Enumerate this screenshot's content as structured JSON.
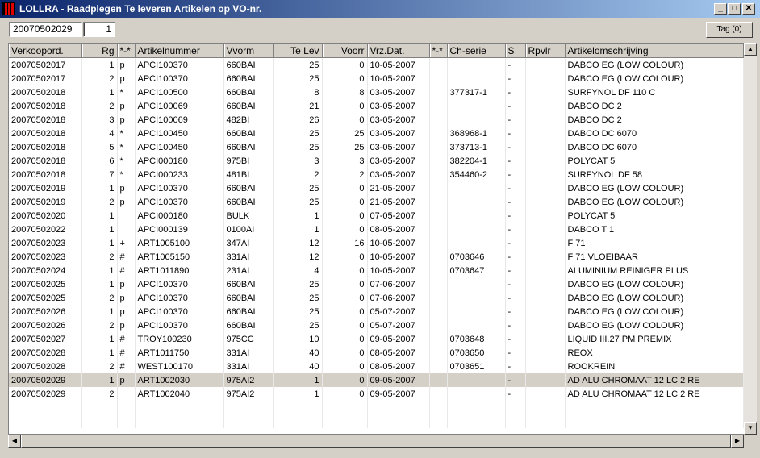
{
  "window": {
    "title": "LOLLRA - Raadplegen Te leveren Artikelen op VO-nr.",
    "minimize": "_",
    "maximize": "□",
    "close": "✕"
  },
  "toolbar": {
    "order_value": "20070502029",
    "row_value": "1",
    "tag_label": "Tag (0)"
  },
  "grid": {
    "columns": [
      "Verkoopord.",
      "Rg",
      "*-*",
      "Artikelnummer",
      "Vvorm",
      "Te Lev",
      "Voorr",
      "Vrz.Dat.",
      "*-*",
      "Ch-serie",
      "S",
      "Rpvlr",
      "Artikelomschrijving"
    ],
    "rows": [
      [
        "20070502017",
        "1",
        "p",
        "APCI100370",
        "660BAI",
        "25",
        "0",
        "10-05-2007",
        "",
        "",
        "-",
        "",
        "DABCO EG (LOW COLOUR)"
      ],
      [
        "20070502017",
        "2",
        "p",
        "APCI100370",
        "660BAI",
        "25",
        "0",
        "10-05-2007",
        "",
        "",
        "-",
        "",
        "DABCO EG (LOW COLOUR)"
      ],
      [
        "20070502018",
        "1",
        "*",
        "APCI100500",
        "660BAI",
        "8",
        "8",
        "03-05-2007",
        "",
        "377317-1",
        "-",
        "",
        "SURFYNOL DF 110 C"
      ],
      [
        "20070502018",
        "2",
        "p",
        "APCI100069",
        "660BAI",
        "21",
        "0",
        "03-05-2007",
        "",
        "",
        "-",
        "",
        "DABCO DC 2"
      ],
      [
        "20070502018",
        "3",
        "p",
        "APCI100069",
        "482BI",
        "26",
        "0",
        "03-05-2007",
        "",
        "",
        "-",
        "",
        "DABCO DC 2"
      ],
      [
        "20070502018",
        "4",
        "*",
        "APCI100450",
        "660BAI",
        "25",
        "25",
        "03-05-2007",
        "",
        "368968-1",
        "-",
        "",
        "DABCO DC 6070"
      ],
      [
        "20070502018",
        "5",
        "*",
        "APCI100450",
        "660BAI",
        "25",
        "25",
        "03-05-2007",
        "",
        "373713-1",
        "-",
        "",
        "DABCO DC 6070"
      ],
      [
        "20070502018",
        "6",
        "*",
        "APCI000180",
        "975BI",
        "3",
        "3",
        "03-05-2007",
        "",
        "382204-1",
        "-",
        "",
        "POLYCAT 5"
      ],
      [
        "20070502018",
        "7",
        "*",
        "APCI000233",
        "481BI",
        "2",
        "2",
        "03-05-2007",
        "",
        "354460-2",
        "-",
        "",
        "SURFYNOL DF 58"
      ],
      [
        "20070502019",
        "1",
        "p",
        "APCI100370",
        "660BAI",
        "25",
        "0",
        "21-05-2007",
        "",
        "",
        "-",
        "",
        "DABCO EG (LOW COLOUR)"
      ],
      [
        "20070502019",
        "2",
        "p",
        "APCI100370",
        "660BAI",
        "25",
        "0",
        "21-05-2007",
        "",
        "",
        "-",
        "",
        "DABCO EG (LOW COLOUR)"
      ],
      [
        "20070502020",
        "1",
        "",
        "APCI000180",
        "BULK",
        "1",
        "0",
        "07-05-2007",
        "",
        "",
        "-",
        "",
        "POLYCAT 5"
      ],
      [
        "20070502022",
        "1",
        "",
        "APCI000139",
        "0100AI",
        "1",
        "0",
        "08-05-2007",
        "",
        "",
        "-",
        "",
        "DABCO T 1"
      ],
      [
        "20070502023",
        "1",
        "+",
        "ART1005100",
        "347AI",
        "12",
        "16",
        "10-05-2007",
        "",
        "",
        "-",
        "",
        "F 71"
      ],
      [
        "20070502023",
        "2",
        "#",
        "ART1005150",
        "331AI",
        "12",
        "0",
        "10-05-2007",
        "",
        "0703646",
        "-",
        "",
        "F 71 VLOEIBAAR"
      ],
      [
        "20070502024",
        "1",
        "#",
        "ART1011890",
        "231AI",
        "4",
        "0",
        "10-05-2007",
        "",
        "0703647",
        "-",
        "",
        "ALUMINIUM REINIGER PLUS"
      ],
      [
        "20070502025",
        "1",
        "p",
        "APCI100370",
        "660BAI",
        "25",
        "0",
        "07-06-2007",
        "",
        "",
        "-",
        "",
        "DABCO EG (LOW COLOUR)"
      ],
      [
        "20070502025",
        "2",
        "p",
        "APCI100370",
        "660BAI",
        "25",
        "0",
        "07-06-2007",
        "",
        "",
        "-",
        "",
        "DABCO EG (LOW COLOUR)"
      ],
      [
        "20070502026",
        "1",
        "p",
        "APCI100370",
        "660BAI",
        "25",
        "0",
        "05-07-2007",
        "",
        "",
        "-",
        "",
        "DABCO EG (LOW COLOUR)"
      ],
      [
        "20070502026",
        "2",
        "p",
        "APCI100370",
        "660BAI",
        "25",
        "0",
        "05-07-2007",
        "",
        "",
        "-",
        "",
        "DABCO EG (LOW COLOUR)"
      ],
      [
        "20070502027",
        "1",
        "#",
        "TROY100230",
        "975CC",
        "10",
        "0",
        "09-05-2007",
        "",
        "0703648",
        "-",
        "",
        "LIQUID III.27 PM PREMIX"
      ],
      [
        "20070502028",
        "1",
        "#",
        "ART1011750",
        "331AI",
        "40",
        "0",
        "08-05-2007",
        "",
        "0703650",
        "-",
        "",
        "REOX"
      ],
      [
        "20070502028",
        "2",
        "#",
        "WEST100170",
        "331AI",
        "40",
        "0",
        "08-05-2007",
        "",
        "0703651",
        "-",
        "",
        "ROOKREIN"
      ],
      [
        "20070502029",
        "1",
        "p",
        "ART1002030",
        "975AI2",
        "1",
        "0",
        "09-05-2007",
        "",
        "",
        "-",
        "",
        "AD ALU CHROMAAT 12 LC 2 RE"
      ],
      [
        "20070502029",
        "2",
        "",
        "ART1002040",
        "975AI2",
        "1",
        "0",
        "09-05-2007",
        "",
        "",
        "-",
        "",
        "AD ALU CHROMAAT 12 LC 2 RE"
      ]
    ],
    "selected_row": 23
  },
  "scroll": {
    "up": "▲",
    "down": "▼",
    "left": "◀",
    "right": "▶"
  }
}
